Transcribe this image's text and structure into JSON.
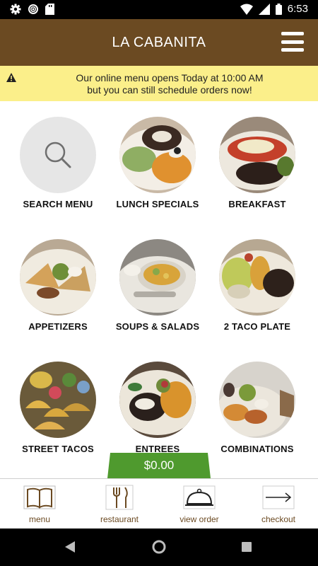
{
  "status_bar": {
    "time": "6:53"
  },
  "header": {
    "title": "LA CABANITA"
  },
  "notice": {
    "line1": "Our online menu opens Today at 10:00 AM",
    "line2": "but you can still schedule orders now!"
  },
  "tiles": [
    {
      "label": "SEARCH MENU"
    },
    {
      "label": "LUNCH SPECIALS"
    },
    {
      "label": "BREAKFAST"
    },
    {
      "label": "APPETIZERS"
    },
    {
      "label": "SOUPS & SALADS"
    },
    {
      "label": "2 TACO PLATE"
    },
    {
      "label": "STREET TACOS"
    },
    {
      "label": "ENTREES"
    },
    {
      "label": "COMBINATIONS"
    }
  ],
  "cart": {
    "total": "$0.00"
  },
  "bottom_nav": [
    {
      "label": "menu",
      "icon": "book-icon"
    },
    {
      "label": "restaurant",
      "icon": "fork-knife-icon"
    },
    {
      "label": "view order",
      "icon": "cloche-icon"
    },
    {
      "label": "checkout",
      "icon": "arrow-right-icon"
    }
  ],
  "colors": {
    "header": "#6b4a22",
    "notice": "#fbef8a",
    "cart": "#4f9a2e"
  }
}
